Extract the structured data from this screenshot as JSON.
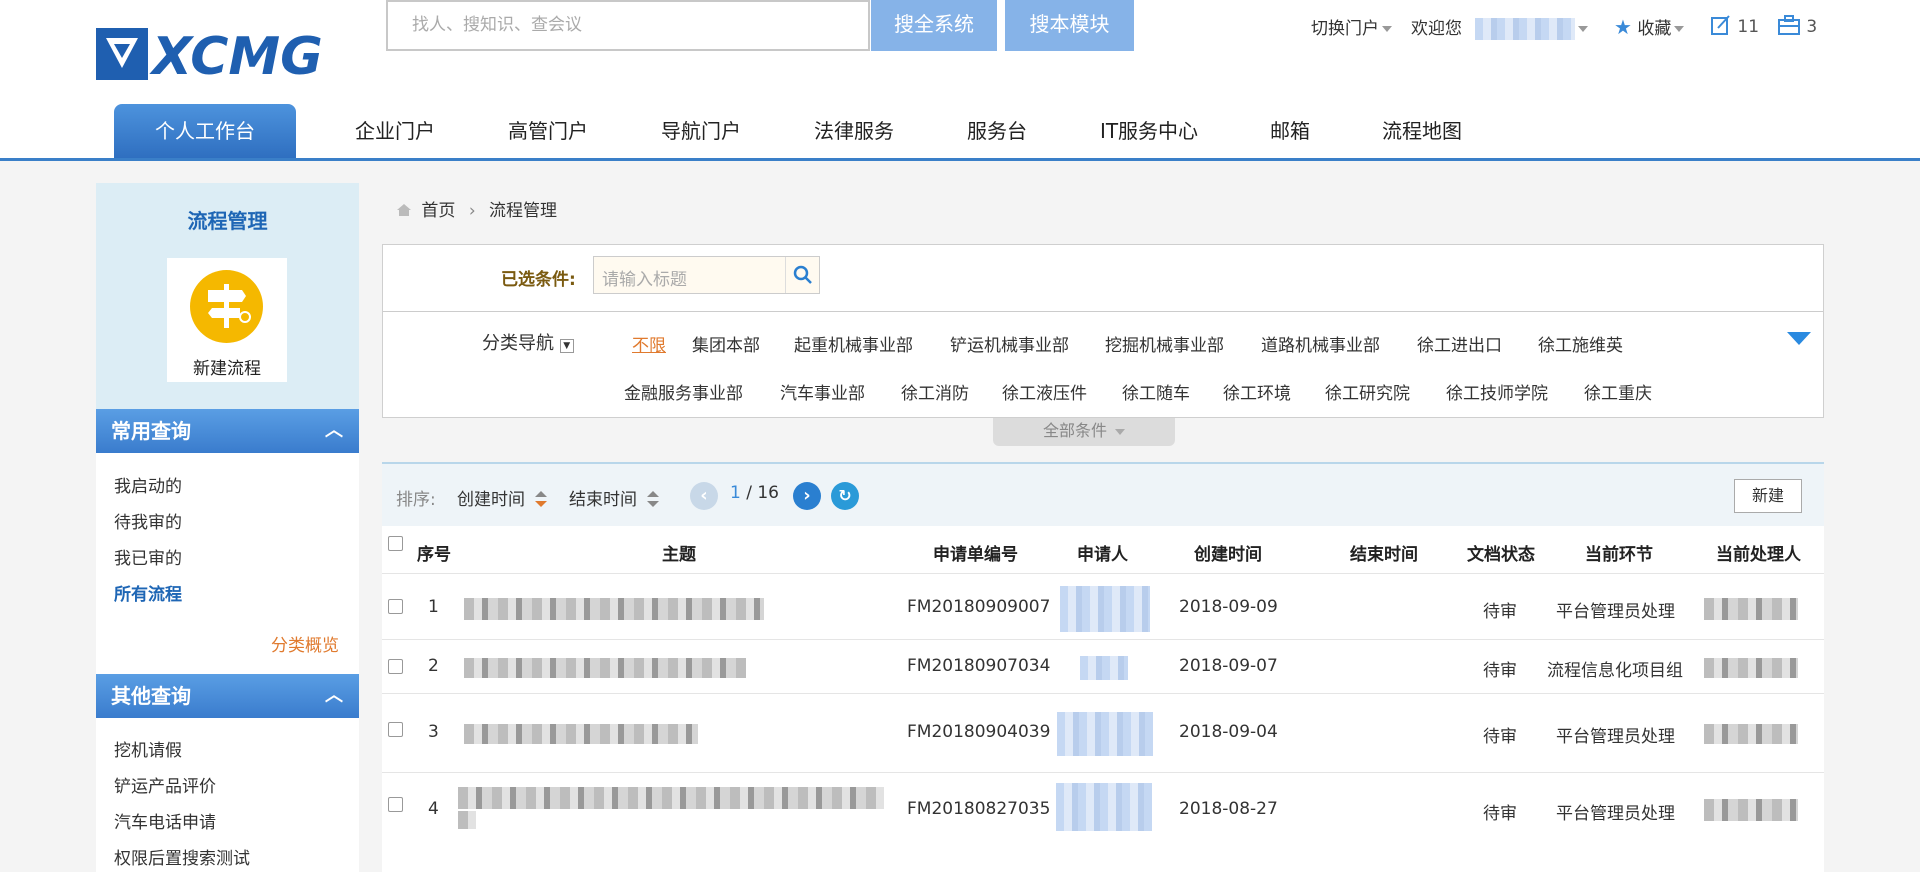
{
  "header": {
    "search_placeholder": "找人、搜知识、查会议",
    "search_all_label": "搜全系统",
    "search_module_label": "搜本模块",
    "switch_portal": "切换门户",
    "welcome": "欢迎您",
    "favorites": "收藏",
    "edit_count": "11",
    "briefcase_count": "3"
  },
  "nav": [
    "个人工作台",
    "企业门户",
    "高管门户",
    "导航门户",
    "法律服务",
    "服务台",
    "IT服务中心",
    "邮箱",
    "流程地图"
  ],
  "sidebar": {
    "title": "流程管理",
    "new_process": "新建流程",
    "common_query": "常用查询",
    "common_items": [
      "我启动的",
      "待我审的",
      "我已审的",
      "所有流程"
    ],
    "category_overview": "分类概览",
    "other_query": "其他查询",
    "other_items": [
      "挖机请假",
      "铲运产品评价",
      "汽车电话申请",
      "权限后置搜索测试"
    ]
  },
  "breadcrumb": {
    "home": "首页",
    "current": "流程管理"
  },
  "filter": {
    "selected_label": "已选条件:",
    "title_placeholder": "请输入标题",
    "category_nav": "分类导航",
    "categories_row1": [
      "不限",
      "集团本部",
      "起重机械事业部",
      "铲运机械事业部",
      "挖掘机械事业部",
      "道路机械事业部",
      "徐工进出口",
      "徐工施维英"
    ],
    "categories_row2": [
      "金融服务事业部",
      "汽车事业部",
      "徐工消防",
      "徐工液压件",
      "徐工随车",
      "徐工环境",
      "徐工研究院",
      "徐工技师学院",
      "徐工重庆"
    ],
    "all_conditions": "全部条件"
  },
  "toolbar": {
    "sort_label": "排序:",
    "sort_created": "创建时间",
    "sort_ended": "结束时间",
    "page_current": "1",
    "page_sep": "/ 16",
    "new_label": "新建"
  },
  "table": {
    "headers": [
      "序号",
      "主题",
      "申请单编号",
      "申请人",
      "创建时间",
      "结束时间",
      "文档状态",
      "当前环节",
      "当前处理人"
    ],
    "rows": [
      {
        "seq": "1",
        "code": "FM20180909007",
        "created": "2018-09-09",
        "status": "待审",
        "step": "平台管理员处理"
      },
      {
        "seq": "2",
        "code": "FM20180907034",
        "created": "2018-09-07",
        "status": "待审",
        "step": "流程信息化项目组"
      },
      {
        "seq": "3",
        "code": "FM20180904039",
        "created": "2018-09-04",
        "status": "待审",
        "step": "平台管理员处理"
      },
      {
        "seq": "4",
        "code": "FM20180827035",
        "created": "2018-08-27",
        "status": "待审",
        "step": "平台管理员处理"
      }
    ]
  },
  "colors": {
    "accent": "#3a7fc8",
    "search_btn": "#86b3e8",
    "orange_link": "#e07a2e"
  }
}
